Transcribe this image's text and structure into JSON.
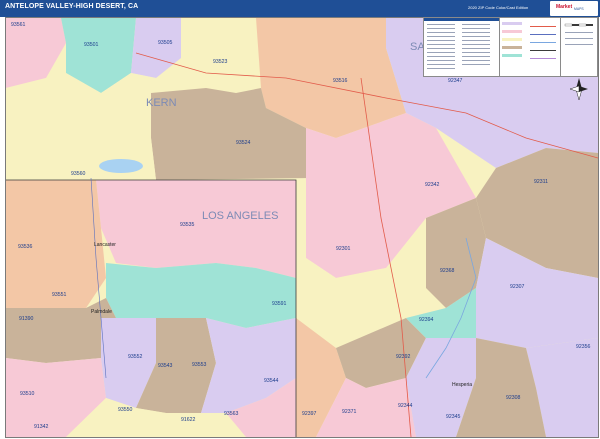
{
  "map": {
    "title": "ANTELOPE VALLEY-HIGH DESERT, CA",
    "edition": "2020 ZIP Code Color/Cast Edition",
    "counties": {
      "kern": "KERN",
      "los_angeles": "LOS ANGELES",
      "san_bernardino": "SAN"
    },
    "cities": {
      "lancaster": "Lancaster",
      "palmdale": "Palmdale",
      "hesperia": "Hesperia"
    },
    "zip_labels": {
      "z93561": "93561",
      "z93501": "93501",
      "z93505": "93505",
      "z93523": "93523",
      "z93516": "93516",
      "z92347": "92347",
      "z93524": "93524",
      "z93560": "93560",
      "z93535": "93535",
      "z92342": "92342",
      "z92311": "92311",
      "z93536": "93536",
      "z92301": "92301",
      "z92368": "92368",
      "z92307": "92307",
      "z93551": "93551",
      "z93591": "93591",
      "z91390": "91390",
      "z92394": "92394",
      "z92356": "92356",
      "z93552": "93552",
      "z93543": "93543",
      "z93553": "93553",
      "z92392": "92392",
      "z93544": "93544",
      "z93510": "93510",
      "z93550": "93550",
      "z93563": "93563",
      "z92397": "92397",
      "z92371": "92371",
      "z92344": "92344",
      "z92345": "92345",
      "z92308": "92308",
      "z91342": "91342",
      "z91622": "91622"
    },
    "logo": {
      "brand": "Market",
      "sub": "MAPS"
    },
    "compass": "N"
  },
  "colors": {
    "title_bar": "#1f4f96",
    "pink": "#f7c9d6",
    "yellow": "#f8f2c1",
    "lavender": "#d9ccf0",
    "brown": "#c9b39a",
    "teal": "#9fe3d6",
    "peach": "#f3c7a6",
    "blue_text": "#1b3c8c"
  }
}
